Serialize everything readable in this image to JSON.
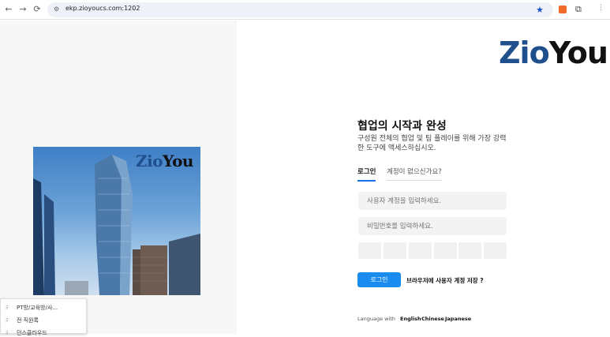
{
  "browser": {
    "url": "ekp.zioyoucs.com:1202"
  },
  "brand": {
    "part1": "Zio",
    "part2": "You",
    "color1": "#1f4f8c",
    "color2": "#111111"
  },
  "hero": {
    "logo_part1": "Zio",
    "logo_part2": "You"
  },
  "context_menu": {
    "items": [
      "PT방/교육방/사...",
      "전 직원록",
      "던스클라우드"
    ]
  },
  "login": {
    "title": "협업의 시작과 완성",
    "subtitle": "구성원 전체의 협업 및 팀 플레이를 위해 가장 강력한 도구에 액세스하십시오.",
    "tab_login": "로그인",
    "tab_no_account": "계정이 없으신가요?",
    "account_placeholder": "사용자 계정을 입력하세요.",
    "password_placeholder": "비밀번호를 입력하세요.",
    "login_button": "로그인",
    "save_question": "브라우저에 사용자 계정 저장 ?",
    "accent": "#1a8cf0"
  },
  "language": {
    "label": "Language with",
    "options": [
      "English",
      "Chinese",
      "Japanese"
    ]
  }
}
